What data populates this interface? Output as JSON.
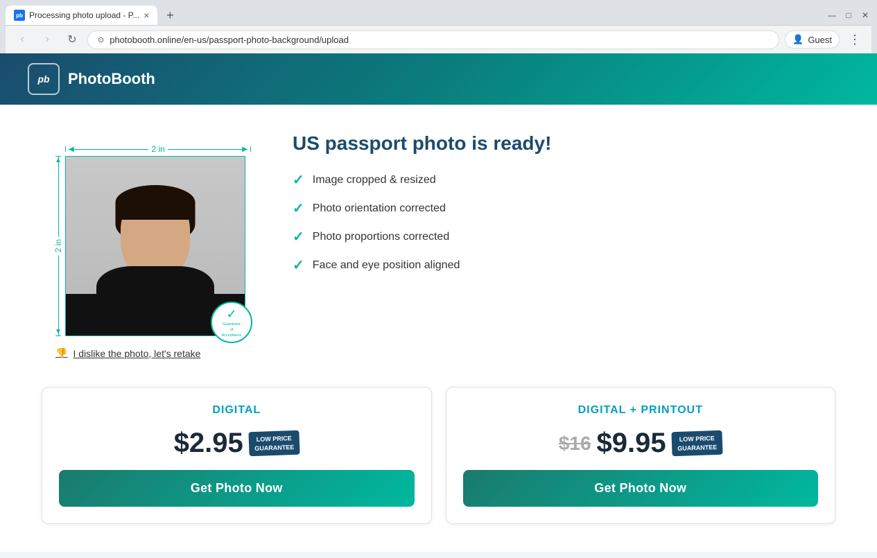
{
  "browser": {
    "tab": {
      "favicon": "pb",
      "title": "Processing photo upload - P...",
      "close": "×"
    },
    "new_tab": "+",
    "nav": {
      "back": "‹",
      "forward": "›",
      "refresh": "↻",
      "security": "⊙"
    },
    "url": "photobooth.online/en-us/passport-photo-background/upload",
    "profile_label": "Guest",
    "menu": "⋮",
    "window_controls": {
      "minimize": "—",
      "maximize": "□",
      "close": "✕"
    }
  },
  "header": {
    "logo_text_icon": "pb",
    "logo_text": "PhotoBooth"
  },
  "main": {
    "photo": {
      "dimension_top": "2 in",
      "dimension_side": "2 in",
      "guarantee_line1": "Guarantee",
      "guarantee_line2": "of",
      "guarantee_line3": "Acceptance",
      "retake_label": "I dislike the photo, let's retake"
    },
    "info": {
      "title": "US passport photo is ready!",
      "checklist": [
        "Image cropped & resized",
        "Photo orientation corrected",
        "Photo proportions corrected",
        "Face and eye position aligned"
      ]
    },
    "pricing": {
      "digital": {
        "title": "DIGITAL",
        "price": "$2.95",
        "badge_line1": "LOW PRICE",
        "badge_line2": "GUARANTEE",
        "cta": "Get Photo Now"
      },
      "digital_print": {
        "title": "DIGITAL + PRINTOUT",
        "price_old": "$16",
        "price": "$9.95",
        "badge_line1": "LOW PRICE",
        "badge_line2": "GUARANTEE",
        "cta": "Get Photo Now"
      }
    }
  }
}
